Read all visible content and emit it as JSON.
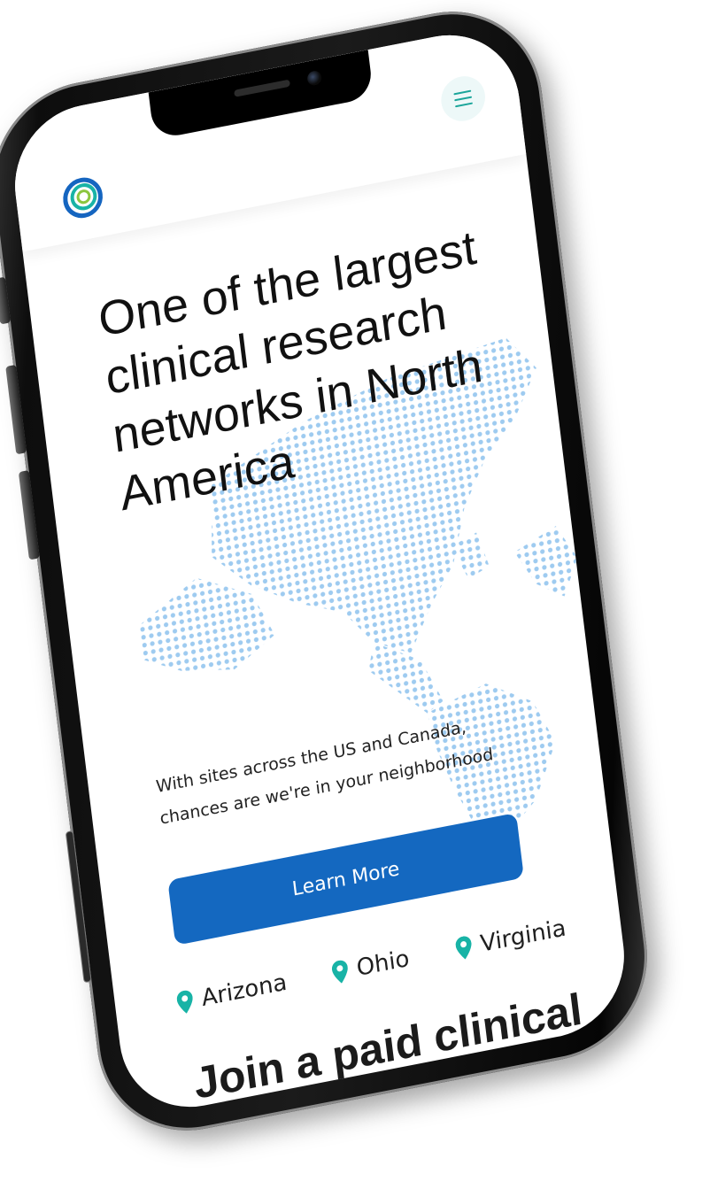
{
  "header": {
    "logo_icon": "concentric-circles-logo-icon",
    "menu_icon": "hamburger-menu-icon"
  },
  "hero": {
    "title": "One of the largest clinical research networks in North America",
    "subtitle": "With sites across the US and Canada, chances are we're in your neighborhood",
    "button_label": "Learn More",
    "background_icon": "dotted-world-map-icon"
  },
  "locations": [
    {
      "name": "Arizona",
      "icon": "map-pin-icon"
    },
    {
      "name": "Ohio",
      "icon": "map-pin-icon"
    },
    {
      "name": "Virginia",
      "icon": "map-pin-icon"
    }
  ],
  "section": {
    "title": "Join a paid clinical research study"
  },
  "colors": {
    "primary_button": "#1468c0",
    "accent_teal": "#18b3a6",
    "map_dots": "#9ecbf0",
    "text": "#111111"
  }
}
